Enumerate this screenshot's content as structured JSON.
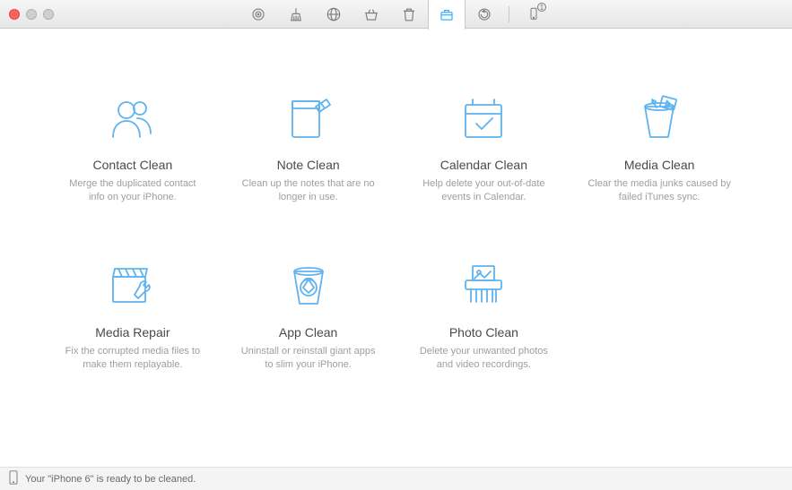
{
  "status": {
    "text": "Your \"iPhone 6\" is ready to be cleaned."
  },
  "cards": [
    {
      "title": "Contact Clean",
      "desc": "Merge the duplicated contact info on your iPhone."
    },
    {
      "title": "Note Clean",
      "desc": "Clean up the notes that are no longer in use."
    },
    {
      "title": "Calendar Clean",
      "desc": "Help delete your out-of-date events in Calendar."
    },
    {
      "title": "Media Clean",
      "desc": "Clear the media junks caused by failed iTunes sync."
    },
    {
      "title": "Media Repair",
      "desc": "Fix the corrupted media files to make them replayable."
    },
    {
      "title": "App Clean",
      "desc": "Uninstall or reinstall giant apps to slim your iPhone."
    },
    {
      "title": "Photo Clean",
      "desc": "Delete your unwanted photos and video recordings."
    }
  ],
  "toolbar": {
    "items": [
      "target",
      "broom",
      "globe",
      "basket",
      "trash",
      "toolbox",
      "refresh"
    ],
    "active_index": 5,
    "device_badge": "1"
  }
}
